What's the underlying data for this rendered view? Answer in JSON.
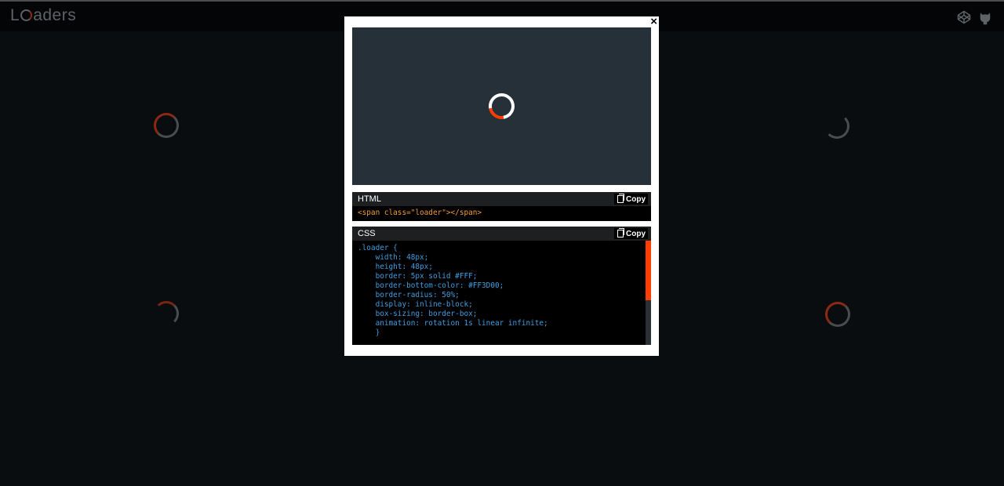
{
  "header": {
    "logo_prefix": "L",
    "logo_suffix": "aders",
    "icons": [
      "codepen-icon",
      "github-icon"
    ]
  },
  "modal": {
    "close_label": "×",
    "html_panel": {
      "title": "HTML",
      "copy_label": "Copy",
      "code": "<span class=\"loader\"></span>"
    },
    "css_panel": {
      "title": "CSS",
      "copy_label": "Copy",
      "code": ".loader {\n    width: 48px;\n    height: 48px;\n    border: 5px solid #FFF;\n    border-bottom-color: #FF3D00;\n    border-radius: 50%;\n    display: inline-block;\n    box-sizing: border-box;\n    animation: rotation 1s linear infinite;\n    }"
    }
  },
  "colors": {
    "accent": "#FF3D00",
    "preview_bg": "#263038",
    "page_bg": "#0a0d10"
  }
}
